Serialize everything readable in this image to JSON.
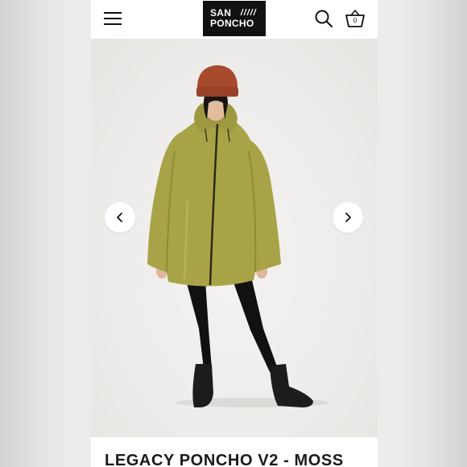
{
  "brand": {
    "line1": "SAN",
    "line2": "PONCHO"
  },
  "header": {
    "cart_count": "0"
  },
  "icons": {
    "menu": "hamburger-menu-icon",
    "search": "search-icon",
    "cart": "basket-icon",
    "prev": "chevron-left-icon",
    "next": "chevron-right-icon"
  },
  "product": {
    "title": "LEGACY PONCHO V2 - MOSS"
  },
  "colors": {
    "poncho": "#a9a347",
    "beanie": "#a84a2c",
    "header_bg": "#ffffff",
    "logo_bg": "#111111"
  }
}
